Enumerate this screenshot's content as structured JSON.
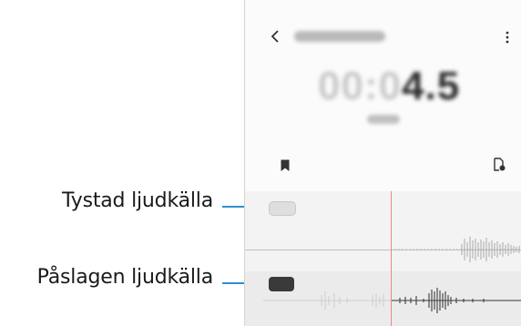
{
  "callouts": {
    "muted": "Tystad ljudkälla",
    "active": "Påslagen ljudkälla"
  },
  "toolbar": {
    "back_icon": "chevron-left-icon",
    "more_icon": "more-vertical-icon",
    "bookmark_icon": "bookmark-icon",
    "save_icon": "document-save-icon"
  },
  "timer": {
    "dim_part": "00:0",
    "main_part": "4.5"
  },
  "colors": {
    "leader": "#2f8fcf",
    "playhead": "#e58a8a"
  }
}
